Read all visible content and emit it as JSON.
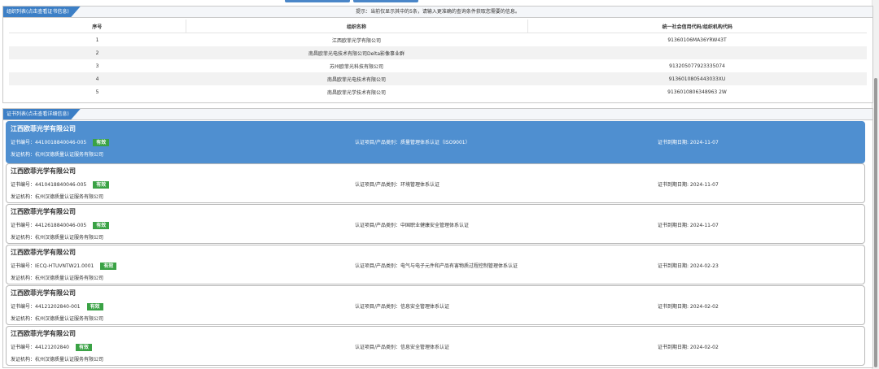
{
  "org_panel": {
    "tab": "组织列表(点击查看证书信息)",
    "tip": "提示：当前仅显示其中的5条，请输入更准确的查询条件获取您需要的信息。",
    "columns": [
      "序号",
      "组织名称",
      "统一社会信用代码/组织机构代码"
    ],
    "rows": [
      {
        "no": "1",
        "name": "江西欧菲光学有限公司",
        "code": "91360106MA36YRW43T"
      },
      {
        "no": "2",
        "name": "南昌欧菲光电技术有限公司Delta影像事业群",
        "code": ""
      },
      {
        "no": "3",
        "name": "苏州欧菲光科技有限公司",
        "code": "913205077923335074"
      },
      {
        "no": "4",
        "name": "南昌欧菲光电技术有限公司",
        "code": "9136010805443033XU"
      },
      {
        "no": "5",
        "name": "南昌欧菲光学技术有限公司",
        "code": "9136010806348963 2W"
      }
    ]
  },
  "cert_panel": {
    "tab": "证书列表(点击查看详细信息)",
    "items": [
      {
        "company": "江西欧菲光学有限公司",
        "cert_no": "证书编号：4410018840046-005",
        "status": "有效",
        "project": "认证项目/产品类别：质量管理体系认证（ISO9001）",
        "expiry": "证书到期日期: 2024-11-07",
        "org": "发证机构：杭州汉德质量认证服务有限公司"
      },
      {
        "company": "江西欧菲光学有限公司",
        "cert_no": "证书编号：4410418840046-005",
        "status": "有效",
        "project": "认证项目/产品类别：环境管理体系认证",
        "expiry": "证书到期日期: 2024-11-07",
        "org": "发证机构：杭州汉德质量认证服务有限公司"
      },
      {
        "company": "江西欧菲光学有限公司",
        "cert_no": "证书编号：4412618840046-005",
        "status": "有效",
        "project": "认证项目/产品类别：中国职业健康安全管理体系认证",
        "expiry": "证书到期日期: 2024-11-07",
        "org": "发证机构：杭州汉德质量认证服务有限公司"
      },
      {
        "company": "江西欧菲光学有限公司",
        "cert_no": "证书编号：IECQ-HTUVNTW21.0001",
        "status": "有效",
        "project": "认证项目/产品类别：电气与电子元件和产品有害物质过程控制管理体系认证",
        "expiry": "证书到期日期: 2024-02-23",
        "org": "发证机构：杭州汉德质量认证服务有限公司"
      },
      {
        "company": "江西欧菲光学有限公司",
        "cert_no": "证书编号：44121202840-001",
        "status": "有效",
        "project": "认证项目/产品类别：信息安全管理体系认证",
        "expiry": "证书到期日期: 2024-02-02",
        "org": "发证机构：杭州汉德质量认证服务有限公司"
      },
      {
        "company": "江西欧菲光学有限公司",
        "cert_no": "证书编号：44121202840",
        "status": "有效",
        "project": "认证项目/产品类别：信息安全管理体系认证",
        "expiry": "证书到期日期: 2024-02-02",
        "org": "发证机构：杭州汉德质量认证服务有限公司"
      }
    ]
  }
}
